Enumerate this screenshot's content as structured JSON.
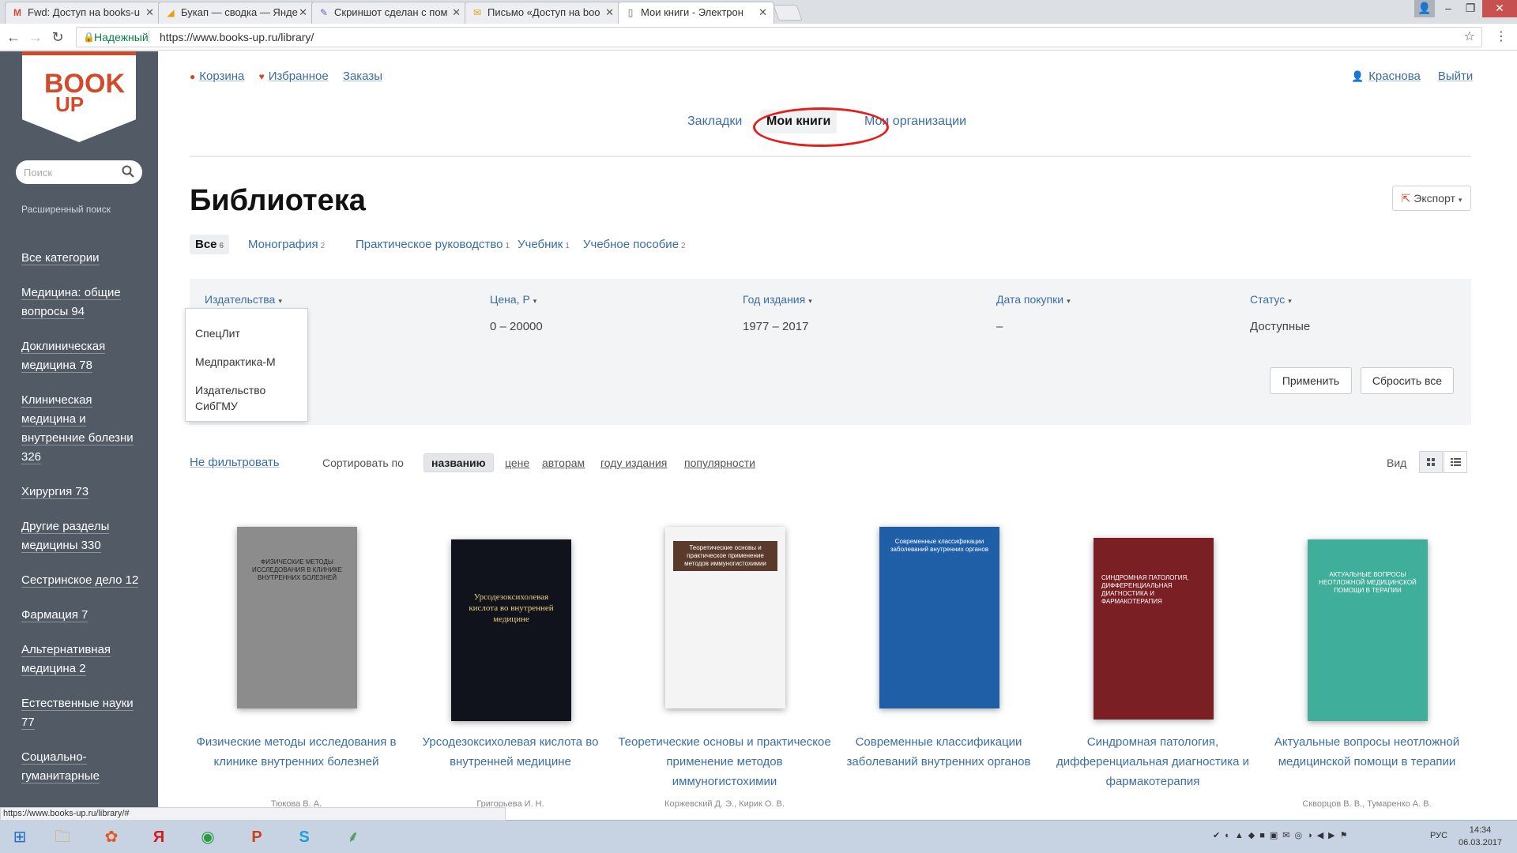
{
  "browser": {
    "tabs": [
      {
        "icon": "gmail-icon",
        "label": "Fwd: Доступ на books-u"
      },
      {
        "icon": "metrika-icon",
        "label": "Букап — сводка — Янде"
      },
      {
        "icon": "feather-icon",
        "label": "Скриншот сделан с пом"
      },
      {
        "icon": "mail-icon",
        "label": "Письмо «Доступ на boo"
      },
      {
        "icon": "page-icon",
        "label": "Мои книги - Электрон"
      }
    ],
    "secure_label": "Надежный",
    "url": "https://www.books-up.ru/library/"
  },
  "sidebar": {
    "logo_top": "BOOK",
    "logo_bottom": "UP",
    "search_placeholder": "Поиск",
    "advanced_search": "Расширенный поиск",
    "categories": [
      "Все категории",
      "Медицина: общие вопросы 94",
      "Доклиническая медицина 78",
      "Клиническая медицина и внутренние болезни 326",
      "Хирургия 73",
      "Другие разделы медицины 330",
      "Сестринское дело 12",
      "Фармация 7",
      "Альтернативная медицина 2",
      "Естественные науки 77",
      "Социально-гуманитарные"
    ]
  },
  "header": {
    "cart": "Корзина",
    "favorites": "Избранное",
    "orders": "Заказы",
    "user": "Краснова",
    "logout": "Выйти"
  },
  "tabs": {
    "bookmarks": "Закладки",
    "my_books": "Мои книги",
    "my_orgs": "Мои организации"
  },
  "page": {
    "title": "Библиотека",
    "export": "Экспорт"
  },
  "type_filters": [
    {
      "label": "Все",
      "count": "6"
    },
    {
      "label": "Монография",
      "count": "2"
    },
    {
      "label": "Практическое руководство",
      "count": "1"
    },
    {
      "label": "Учебник",
      "count": "1"
    },
    {
      "label": "Учебное пособие",
      "count": "2"
    }
  ],
  "filter_panel": {
    "publishers": "Издательства",
    "price": "Цена, Р",
    "price_value": "0 – 20000",
    "year": "Год издания",
    "year_value": "1977 – 2017",
    "purchase_date": "Дата покупки",
    "purchase_value": "–",
    "status": "Статус",
    "status_value": "Доступные",
    "apply": "Применить",
    "reset": "Сбросить все"
  },
  "publisher_dropdown": [
    "СпецЛит",
    "Медпрактика-М",
    "Издательство СибГМУ"
  ],
  "sort": {
    "no_filter": "Не фильтровать",
    "label": "Сортировать по",
    "options": [
      "названию",
      "цене",
      "авторам",
      "году издания",
      "популярности"
    ],
    "view_label": "Вид"
  },
  "books": [
    {
      "title": "Физические методы исследования в клинике внутренних болезней",
      "author": "Тюкова В. А.",
      "cover_color": "#8c8c8c",
      "cover_text": "ФИЗИЧЕСКИЕ МЕТОДЫ ИССЛЕДОВАНИЯ В КЛИНИКЕ ВНУТРЕННИХ БОЛЕЗНЕЙ"
    },
    {
      "title": "Урсодезоксихолевая кислота во внутренней медицине",
      "author": "Григорьева И. Н.",
      "cover_color": "#10121c",
      "cover_text": "Урсодезоксихолевая кислота во внутренней медицине"
    },
    {
      "title": "Теоретические основы и практическое применение методов иммуногистохимии",
      "author": "Коржевский Д. Э., Кирик О. В.",
      "cover_color": "#f4f4f4",
      "cover_text": "Теоретические основы и практическое применение методов иммуногистохимии"
    },
    {
      "title": "Современные классификации заболеваний внутренних органов",
      "author": "",
      "cover_color": "#1f5fa8",
      "cover_text": "Современные классификации заболеваний внутренних органов"
    },
    {
      "title": "Синдромная патология, дифференциальная диагностика и фармакотерапия",
      "author": "",
      "cover_color": "#7a1f24",
      "cover_text": "СИНДРОМНАЯ ПАТОЛОГИЯ, ДИФФЕРЕНЦИАЛЬНАЯ ДИАГНОСТИКА И ФАРМАКОТЕРАПИЯ"
    },
    {
      "title": "Актуальные вопросы неотложной медицинской помощи в терапии",
      "author": "Скворцов В. В., Тумаренко А. В.",
      "cover_color": "#3fae9a",
      "cover_text": "АКТУАЛЬНЫЕ ВОПРОСЫ НЕОТЛОЖНОЙ МЕДИЦИНСКОЙ ПОМОЩИ В ТЕРАПИИ"
    }
  ],
  "status_bar_url": "https://www.books-up.ru/library/#",
  "taskbar": {
    "lang": "РУС",
    "time": "14:34",
    "date": "06.03.2017"
  }
}
